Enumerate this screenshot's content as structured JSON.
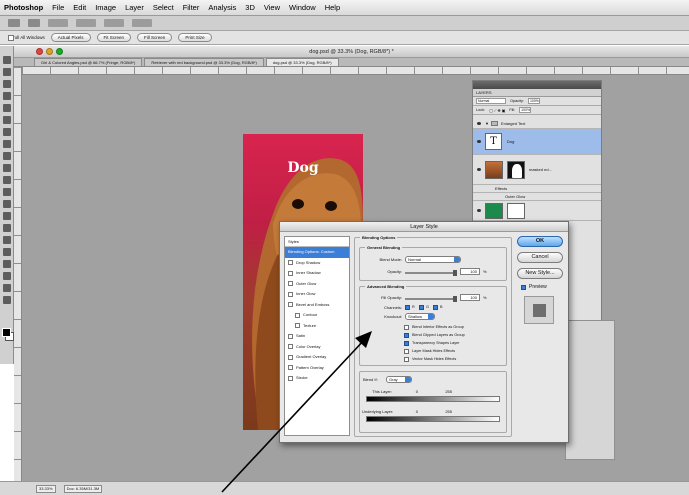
{
  "menubar": {
    "app": "Photoshop",
    "items": [
      "File",
      "Edit",
      "Image",
      "Layer",
      "Select",
      "Filter",
      "Analysis",
      "3D",
      "View",
      "Window",
      "Help"
    ]
  },
  "options_bar": {
    "scroll_all_windows": "Scroll All Windows",
    "buttons": [
      "Actual Pixels",
      "Fit Screen",
      "Fill Screen",
      "Print Size"
    ]
  },
  "document": {
    "title": "dog.psd @ 33.3% (Dog, RGB/8*) *",
    "tabs": [
      "Girl & Colored Angles.psd @ 66.7% (Fringe, RGB/8*)",
      "Retriever with red background.psd @ 33.3% (Dog, RGB/8*)",
      "dog.psd @ 33.3% (Dog, RGB/8*)"
    ],
    "image_text": "Dog"
  },
  "status_bar": {
    "zoom": "33.33%",
    "doc_info": "Doc: 6.35M/31.3M"
  },
  "layers_panel": {
    "title": "LAYERS",
    "blend_mode": "Normal",
    "opacity_label": "Opacity:",
    "opacity": "100%",
    "lock_label": "Lock:",
    "fill_label": "Fill:",
    "fill": "100%",
    "group_name": "Enlarged Text",
    "text_layer": "Dog",
    "dog_layer": "masked ed...",
    "effects_label": "Effects",
    "outer_glow_label": "Outer Glow"
  },
  "layer_style_dialog": {
    "title": "Layer Style",
    "styles_header": "Styles",
    "styles": [
      {
        "label": "Blending Options: Custom",
        "checkbox": false,
        "checked": false,
        "selected": true
      },
      {
        "label": "Drop Shadow",
        "checkbox": true,
        "checked": false,
        "selected": false
      },
      {
        "label": "Inner Shadow",
        "checkbox": true,
        "checked": false,
        "selected": false
      },
      {
        "label": "Outer Glow",
        "checkbox": true,
        "checked": false,
        "selected": false
      },
      {
        "label": "Inner Glow",
        "checkbox": true,
        "checked": false,
        "selected": false
      },
      {
        "label": "Bevel and Emboss",
        "checkbox": true,
        "checked": false,
        "selected": false
      },
      {
        "label": "Contour",
        "checkbox": true,
        "checked": false,
        "selected": false,
        "indent": true
      },
      {
        "label": "Texture",
        "checkbox": true,
        "checked": false,
        "selected": false,
        "indent": true
      },
      {
        "label": "Satin",
        "checkbox": true,
        "checked": false,
        "selected": false
      },
      {
        "label": "Color Overlay",
        "checkbox": true,
        "checked": false,
        "selected": false
      },
      {
        "label": "Gradient Overlay",
        "checkbox": true,
        "checked": false,
        "selected": false
      },
      {
        "label": "Pattern Overlay",
        "checkbox": true,
        "checked": false,
        "selected": false
      },
      {
        "label": "Stroke",
        "checkbox": true,
        "checked": false,
        "selected": false
      }
    ],
    "blending_options": {
      "title": "Blending Options",
      "general": "General Blending",
      "blend_mode_label": "Blend Mode:",
      "blend_mode": "Normal",
      "opacity_label": "Opacity:",
      "opacity": "100",
      "opacity_unit": "%",
      "opacity_level": 1.0,
      "advanced": "Advanced Blending",
      "fill_opacity_label": "Fill Opacity:",
      "fill_opacity": "100",
      "fill_opacity_unit": "%",
      "fill_opacity_level": 1.0,
      "channels_label": "Channels:",
      "channels": [
        "R",
        "G",
        "B"
      ],
      "knockout_label": "Knockout:",
      "knockout": "Shallow",
      "options": [
        {
          "label": "Blend Interior Effects as Group",
          "checked": false
        },
        {
          "label": "Blend Clipped Layers as Group",
          "checked": true
        },
        {
          "label": "Transparency Shapes Layer",
          "checked": true
        },
        {
          "label": "Layer Mask Hides Effects",
          "checked": false
        },
        {
          "label": "Vector Mask Hides Effects",
          "checked": false
        }
      ],
      "blend_if_label": "Blend If:",
      "blend_if": "Gray",
      "this_layer_label": "This Layer:",
      "underlying_label": "Underlying Layer:",
      "range_low": "0",
      "range_high": "255"
    },
    "buttons": {
      "ok": "OK",
      "cancel": "Cancel",
      "new_style": "New Style...",
      "preview": "Preview"
    }
  },
  "colors": {
    "accent": "#3b7ed8",
    "image_bg": "#d8244f"
  }
}
